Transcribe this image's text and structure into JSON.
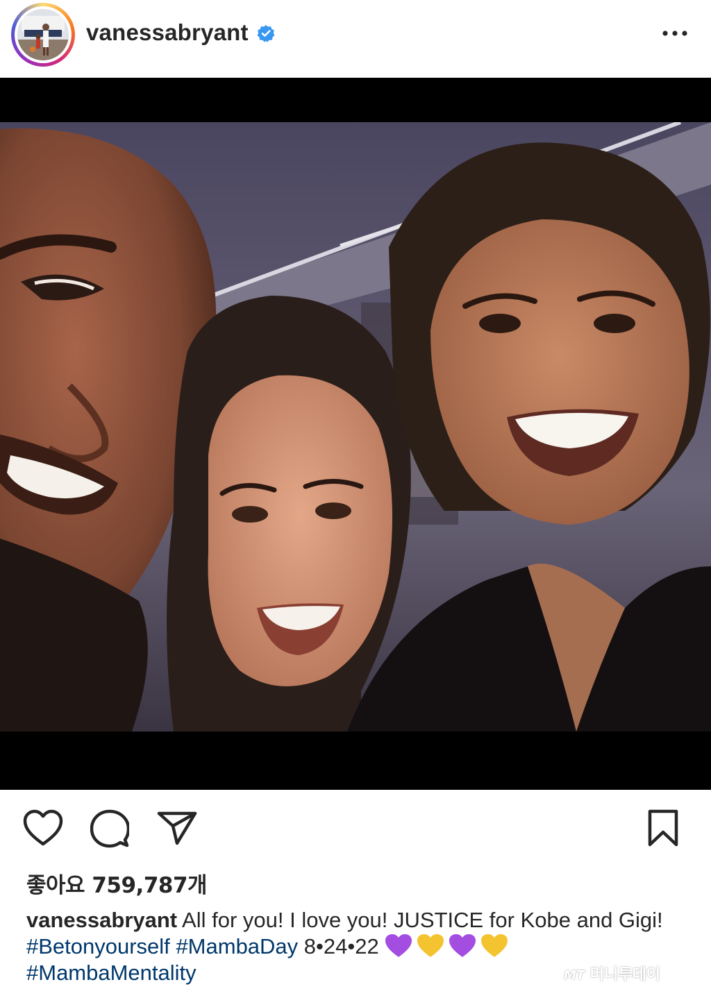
{
  "header": {
    "username": "vanessabryant",
    "verified_icon": "verified-badge-icon",
    "more_icon": "more-options-icon"
  },
  "post": {
    "media_icon_names": [
      "selfie-photo"
    ]
  },
  "actions": {
    "like_icon": "heart-outline-icon",
    "comment_icon": "comment-bubble-icon",
    "share_icon": "paper-plane-icon",
    "save_icon": "bookmark-outline-icon"
  },
  "likes_text": "좋아요 759,787개",
  "caption": {
    "username": "vanessabryant",
    "text1": " All for you! I love you! JUSTICE for Kobe and Gigi! ",
    "tag1": "#Betonyourself",
    "space1": " ",
    "tag2": "#MambaDay",
    "date": " 8•24•22 ",
    "tag3": "#MambaMentality",
    "hearts": [
      "purple",
      "yellow",
      "purple",
      "yellow"
    ]
  },
  "watermark": {
    "mt": "MT",
    "text": "머니투데이"
  },
  "colors": {
    "text": "#262626",
    "hashtag": "#00376b",
    "verified": "#3897f0",
    "purple_heart": "#a34ee0",
    "yellow_heart": "#f4c430"
  }
}
